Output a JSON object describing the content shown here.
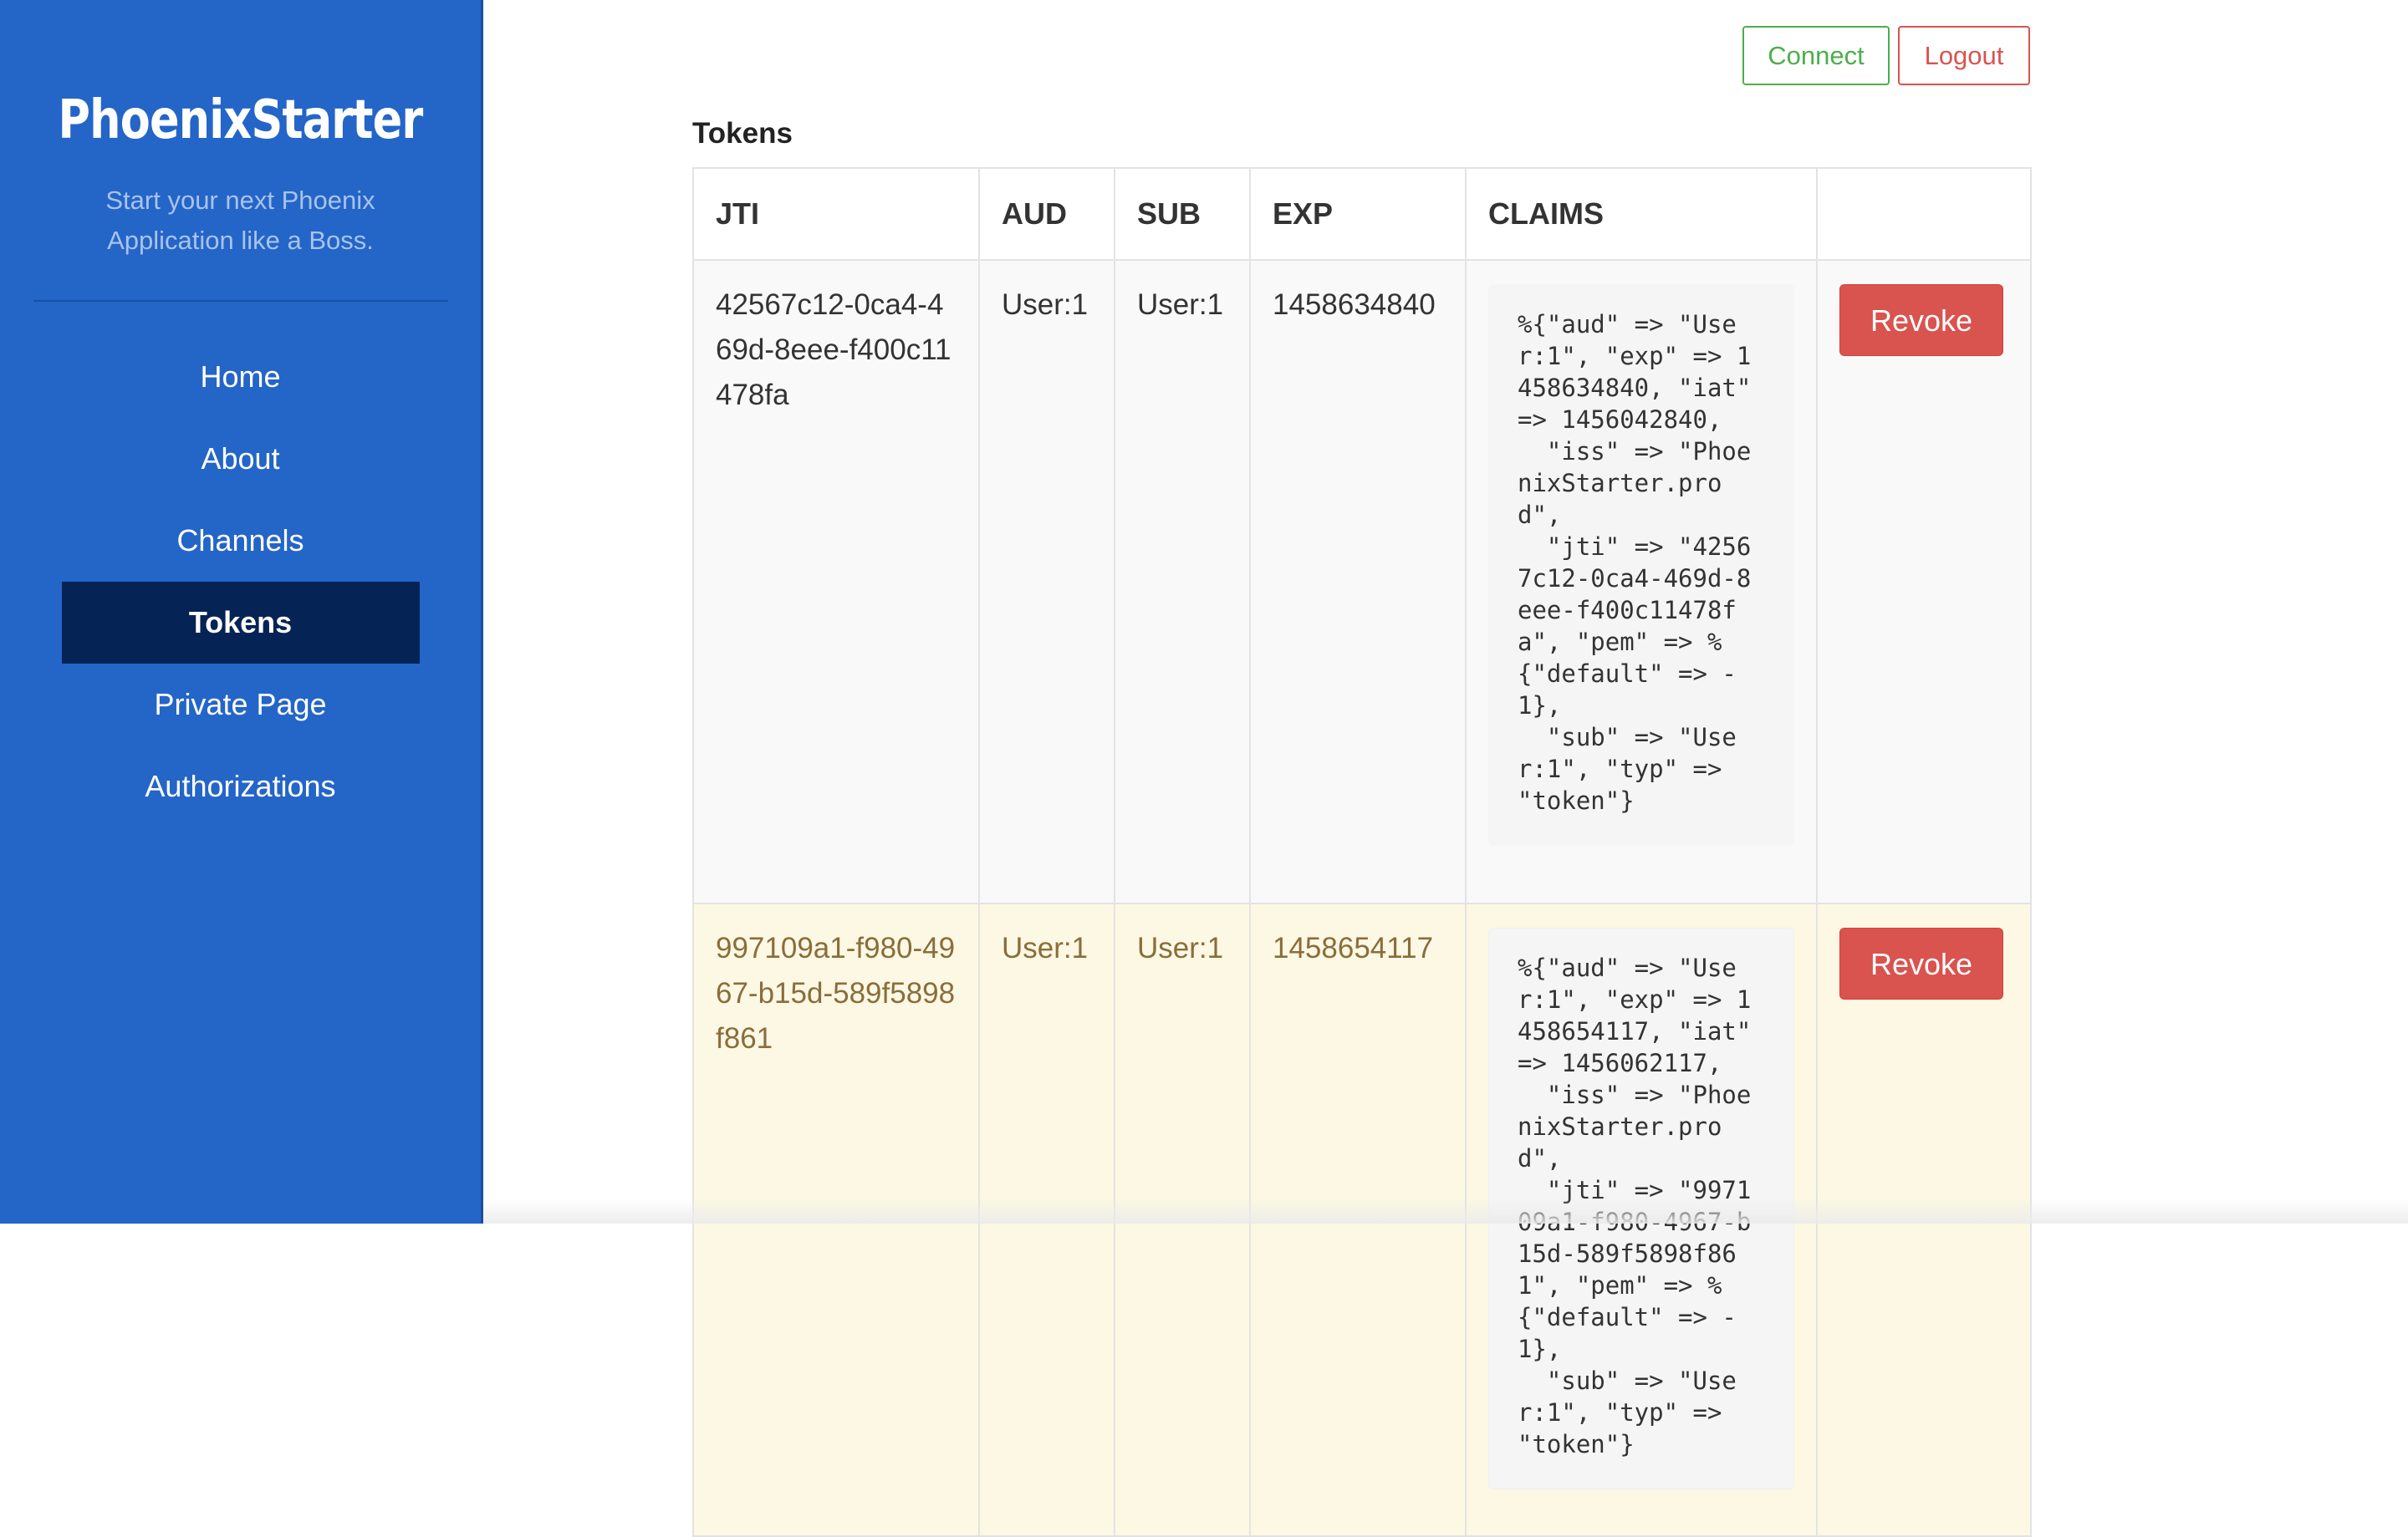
{
  "sidebar": {
    "brand": "PhoenixStarter",
    "tagline": "Start your next Phoenix Application like a Boss.",
    "items": [
      {
        "label": "Home"
      },
      {
        "label": "About"
      },
      {
        "label": "Channels"
      },
      {
        "label": "Tokens",
        "active": true
      },
      {
        "label": "Private Page"
      },
      {
        "label": "Authorizations"
      }
    ]
  },
  "header": {
    "connect_label": "Connect",
    "logout_label": "Logout"
  },
  "main": {
    "title": "Tokens",
    "columns": [
      "JTI",
      "AUD",
      "SUB",
      "EXP",
      "CLAIMS",
      ""
    ],
    "rows": [
      {
        "jti": "42567c12-0ca4-469d-8eee-f400c11478fa",
        "aud": "User:1",
        "sub": "User:1",
        "exp": "1458634840",
        "claims": "%{\"aud\" => \"User:1\", \"exp\" => 1458634840, \"iat\" => 1456042840,\n  \"iss\" => \"PhoenixStarter.prod\",\n  \"jti\" => \"42567c12-0ca4-469d-8eee-f400c11478fa\", \"pem\" => %{\"default\" => -1},\n  \"sub\" => \"User:1\", \"typ\" => \"token\"}",
        "action": "Revoke"
      },
      {
        "jti": "997109a1-f980-4967-b15d-589f5898f861",
        "aud": "User:1",
        "sub": "User:1",
        "exp": "1458654117",
        "claims": "%{\"aud\" => \"User:1\", \"exp\" => 1458654117, \"iat\" => 1456062117,\n  \"iss\" => \"PhoenixStarter.prod\",\n  \"jti\" => \"997109a1-f980-4967-b15d-589f5898f861\", \"pem\" => %{\"default\" => -1},\n  \"sub\" => \"User:1\", \"typ\" => \"token\"}",
        "action": "Revoke"
      }
    ]
  },
  "colors": {
    "sidebar_bg": "#2465c8",
    "sidebar_active": "#062355",
    "connect": "#4cae4c",
    "logout": "#d9534f",
    "revoke": "#d9534f",
    "warning_row": "#fcf8e3"
  }
}
